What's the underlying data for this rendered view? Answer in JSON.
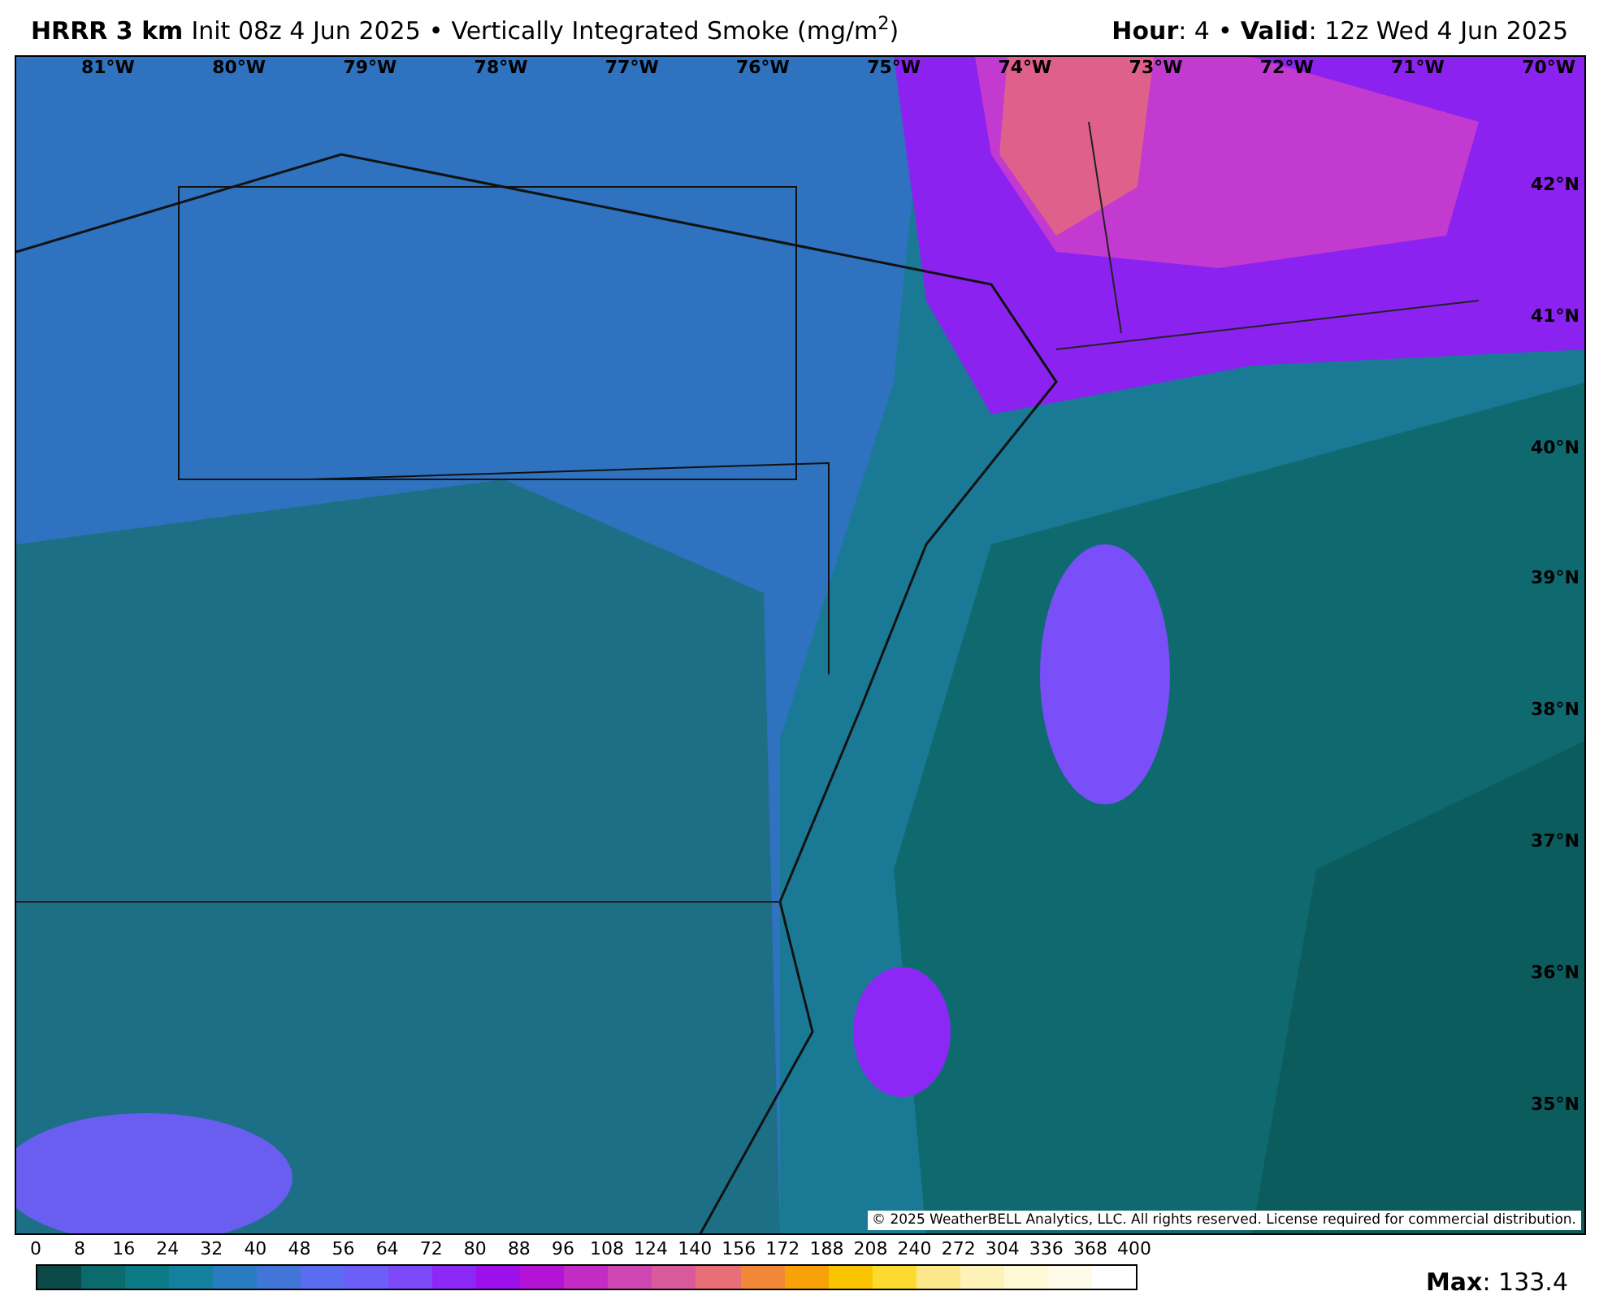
{
  "header": {
    "model": "HRRR 3 km",
    "init": "Init 08z 4 Jun 2025",
    "separator": "•",
    "field": "Vertically Integrated Smoke (mg/m$^{2}$)",
    "hour_label": "Hour",
    "hour": ": 4",
    "separator_2": "•",
    "valid_label": "Valid",
    "valid": ": 12z Wed 4 Jun 2025"
  },
  "map": {
    "kind": "picture",
    "longitudes": [
      "81°W",
      "80°W",
      "79°W",
      "78°W",
      "77°W",
      "76°W",
      "75°W",
      "74°W",
      "73°W",
      "72°W",
      "71°W",
      "70°W"
    ],
    "latitudes": [
      "42°N",
      "41°N",
      "40°N",
      "39°N",
      "38°N",
      "37°N",
      "36°N",
      "35°N"
    ],
    "copyright": "© 2025 WeatherBELL Analytics, LLC. All rights reserved. License required for commercial distribution."
  },
  "colorbar": {
    "stops": [
      {
        "label": "0",
        "color": "#0b4848"
      },
      {
        "label": "8",
        "color": "#0a6a6c"
      },
      {
        "label": "16",
        "color": "#0c7a84"
      },
      {
        "label": "24",
        "color": "#1380a0"
      },
      {
        "label": "32",
        "color": "#2a7cc0"
      },
      {
        "label": "40",
        "color": "#4275d8"
      },
      {
        "label": "48",
        "color": "#5a6cf0"
      },
      {
        "label": "56",
        "color": "#6c5ef8"
      },
      {
        "label": "64",
        "color": "#7d48f8"
      },
      {
        "label": "72",
        "color": "#8c28f5"
      },
      {
        "label": "80",
        "color": "#9c10ec"
      },
      {
        "label": "88",
        "color": "#b412d6"
      },
      {
        "label": "96",
        "color": "#c22cc4"
      },
      {
        "label": "108",
        "color": "#cd46b2"
      },
      {
        "label": "124",
        "color": "#d85a9c"
      },
      {
        "label": "140",
        "color": "#e86e78"
      },
      {
        "label": "156",
        "color": "#f08838"
      },
      {
        "label": "172",
        "color": "#f6a208"
      },
      {
        "label": "188",
        "color": "#fac400"
      },
      {
        "label": "208",
        "color": "#fcda30"
      },
      {
        "label": "240",
        "color": "#fce88a"
      },
      {
        "label": "272",
        "color": "#fdf2b8"
      },
      {
        "label": "304",
        "color": "#fef8d4"
      },
      {
        "label": "336",
        "color": "#fffbe8"
      },
      {
        "label": "368",
        "color": "#ffffff"
      },
      {
        "label": "400"
      }
    ]
  },
  "max": {
    "label": "Max",
    "value": ": 133.4"
  }
}
